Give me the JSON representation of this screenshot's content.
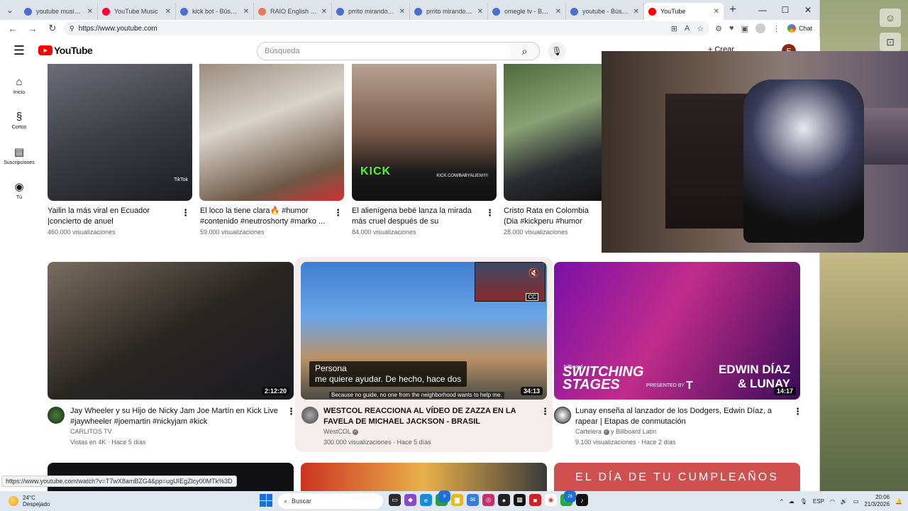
{
  "browser": {
    "tabs": [
      {
        "title": "youtube music - Bú",
        "color": "#4a6fd4"
      },
      {
        "title": "YouTube Music",
        "color": "#ff0033"
      },
      {
        "title": "kick bot - Búsqueda",
        "color": "#4a6fd4"
      },
      {
        "title": "RAIO English Course",
        "color": "#e8785a"
      },
      {
        "title": "prrito mirando de re",
        "color": "#4a6fd4"
      },
      {
        "title": "prrito mirando de re",
        "color": "#4a6fd4"
      },
      {
        "title": "omegle tv - Búsqueda",
        "color": "#4a6fd4"
      },
      {
        "title": "youtube - Búsqueda",
        "color": "#4a6fd4"
      },
      {
        "title": "YouTube",
        "color": "#ff0000",
        "active": true
      }
    ],
    "url": "https://www.youtube.com",
    "chat_label": "Chat",
    "status_url": "https://www.youtube.com/watch?v=T7wX8amBZG4&pp=ugUIEgZlcy00MTk%3D"
  },
  "youtube": {
    "logo": "YouTube",
    "search_placeholder": "Búsqueda",
    "create_label": "Crear",
    "avatar_letter": "E",
    "sidebar": [
      {
        "label": "Inicio",
        "icon": "⌂"
      },
      {
        "label": "Cortos",
        "icon": "§"
      },
      {
        "label": "Suscripciones",
        "icon": "▤"
      },
      {
        "label": "Tú",
        "icon": "◉"
      }
    ],
    "row1": [
      {
        "title": "Yailin la más viral en Ecuador |concierto de anuel",
        "views": "460.000 visualizaciones"
      },
      {
        "title": "El loco la tiene clara🔥 #humor #contenido #neutroshorty #marko ...",
        "views": "59.000 visualizaciones"
      },
      {
        "title": "El alienígena bebé lanza la mirada más cruel después de su respuesta....",
        "views": "84.000 visualizaciones",
        "overlay": "KICK",
        "overlay_url": "KICK.COM/BABYALIEN!!!!!"
      },
      {
        "title": "Cristo Rata en Colombia (Dia #kickperu #humor #cristorata",
        "views": "28.000 visualizaciones"
      }
    ],
    "row1_tiktok": "TikTok",
    "row2": [
      {
        "title": "Jay Wheeler y su Hijo de Nicky Jam Joe Martín en Kick Live #jaywheeler #joemartin #nickyjam #kick",
        "channel": "CARLITOS TV",
        "meta": "Vistas en 4K · Hace 5 días",
        "duration": "2:12:20"
      },
      {
        "title": "WESTCOL REACCIONA AL VÍDEO DE ZAZZA EN LA FAVELA DE MICHAEL JACKSON - BRASIL",
        "channel": "WestCOL",
        "meta": "300.000 visualizaciones · Hace 5 días",
        "duration": "34:13",
        "caption_1": "Persona",
        "caption_2": "me quiere ayudar. De hecho, hace dos",
        "subline": "Because no guide, no one from the neighborhood wants to help me.",
        "cc": "CC"
      },
      {
        "title": "Lunay enseña al lanzador de los Dodgers, Edwin Díaz, a rapear | Etapas de conmutación",
        "channel": "Cartelera",
        "channel_extra": "y Billboard Latin",
        "meta": "9.100 visualizaciones · Hace 2 días",
        "duration": "14:17",
        "brand": "billboard",
        "big1": "SWITCHING",
        "big2": "STAGES",
        "name1": "EDWIN DÍAZ",
        "name2": "& LUNAY",
        "presented": "PRESENTED BY",
        "sponsor": "T"
      }
    ],
    "row3_text": "EL DÍA DE TU CUMPLEAÑOS"
  },
  "taskbar": {
    "temp": "24°C",
    "weather": "Despejado",
    "search": "Buscar",
    "lang": "ESP",
    "time": "20:06",
    "date": "21/3/2026",
    "badge1": "8",
    "badge2": "26"
  }
}
